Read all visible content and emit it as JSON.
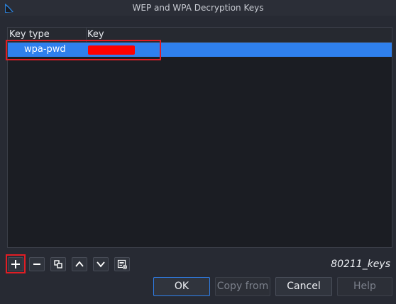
{
  "window": {
    "title": "WEP and WPA Decryption Keys"
  },
  "table": {
    "headers": [
      "Key type",
      "Key"
    ],
    "rows": [
      {
        "type": "wpa-pwd",
        "key": "[redacted]"
      }
    ]
  },
  "toolbar": {
    "icons": [
      "add-icon",
      "remove-icon",
      "copy-icon",
      "move-up-icon",
      "move-down-icon",
      "clear-icon"
    ],
    "file_label": "80211_keys"
  },
  "buttons": {
    "ok": "OK",
    "copy_from": "Copy from",
    "cancel": "Cancel",
    "help": "Help"
  },
  "colors": {
    "selection": "#2f80ed",
    "annotation": "#e11d24",
    "redaction": "#ff0000"
  }
}
